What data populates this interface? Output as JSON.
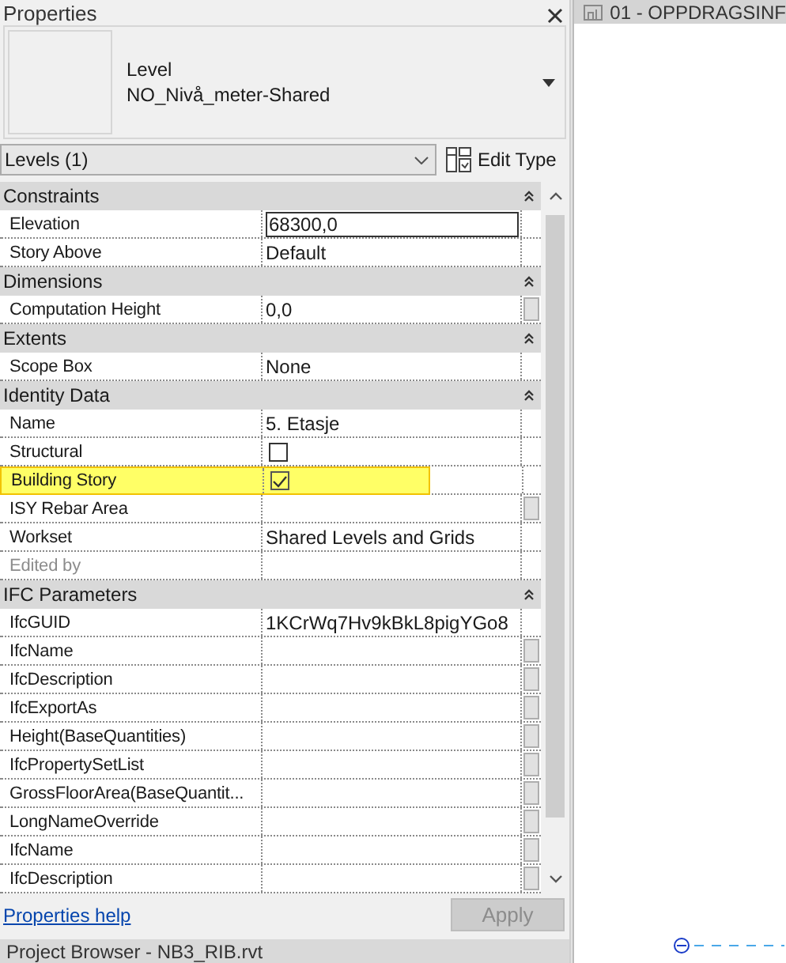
{
  "panel": {
    "title": "Properties",
    "type_selector": {
      "category": "Level",
      "type_name": "NO_Nivå_meter-Shared"
    },
    "filter": {
      "value": "Levels (1)"
    },
    "edit_type_button": "Edit Type"
  },
  "sections": [
    {
      "title": "Constraints",
      "expanded": true,
      "rows": [
        {
          "label": "Elevation",
          "kind": "input",
          "value": "68300,0",
          "button": false,
          "disabled": false,
          "highlighted": false
        },
        {
          "label": "Story Above",
          "kind": "text",
          "value": "Default",
          "button": false,
          "disabled": false,
          "highlighted": false
        }
      ]
    },
    {
      "title": "Dimensions",
      "expanded": true,
      "rows": [
        {
          "label": "Computation Height",
          "kind": "text",
          "value": "0,0",
          "button": true,
          "disabled": false,
          "highlighted": false
        }
      ]
    },
    {
      "title": "Extents",
      "expanded": true,
      "rows": [
        {
          "label": "Scope Box",
          "kind": "text",
          "value": "None",
          "button": false,
          "disabled": false,
          "highlighted": false
        }
      ]
    },
    {
      "title": "Identity Data",
      "expanded": true,
      "rows": [
        {
          "label": "Name",
          "kind": "text",
          "value": "5. Etasje",
          "button": false,
          "disabled": false,
          "highlighted": false
        },
        {
          "label": "Structural",
          "kind": "checkbox",
          "checked": false,
          "button": false,
          "disabled": false,
          "highlighted": false
        },
        {
          "label": "Building Story",
          "kind": "checkbox",
          "checked": true,
          "button": false,
          "disabled": false,
          "highlighted": true
        },
        {
          "label": "ISY Rebar Area",
          "kind": "text",
          "button": true,
          "disabled": false,
          "highlighted": false
        },
        {
          "label": "Workset",
          "kind": "text",
          "value": "Shared Levels and Grids",
          "button": false,
          "disabled": false,
          "highlighted": false
        },
        {
          "label": "Edited by",
          "kind": "text",
          "button": false,
          "disabled": true,
          "highlighted": false
        }
      ]
    },
    {
      "title": "IFC Parameters",
      "expanded": true,
      "rows": [
        {
          "label": "IfcGUID",
          "kind": "text",
          "value": "1KCrWq7Hv9kBkL8pigYGo8",
          "button": false,
          "disabled": false,
          "highlighted": false
        },
        {
          "label": "IfcName",
          "kind": "text",
          "button": true,
          "disabled": false,
          "highlighted": false
        },
        {
          "label": "IfcDescription",
          "kind": "text",
          "button": true,
          "disabled": false,
          "highlighted": false
        },
        {
          "label": "IfcExportAs",
          "kind": "text",
          "button": true,
          "disabled": false,
          "highlighted": false
        },
        {
          "label": "Height(BaseQuantities)",
          "kind": "text",
          "button": true,
          "disabled": false,
          "highlighted": false
        },
        {
          "label": "IfcPropertySetList",
          "kind": "text",
          "button": true,
          "disabled": false,
          "highlighted": false
        },
        {
          "label": "GrossFloorArea(BaseQuantit...",
          "kind": "text",
          "button": true,
          "disabled": false,
          "highlighted": false
        },
        {
          "label": "LongNameOverride",
          "kind": "text",
          "button": true,
          "disabled": false,
          "highlighted": false
        },
        {
          "label": "IfcName",
          "kind": "text",
          "button": true,
          "disabled": false,
          "highlighted": false
        },
        {
          "label": "IfcDescription",
          "kind": "text",
          "button": true,
          "disabled": false,
          "highlighted": false
        }
      ]
    }
  ],
  "footer": {
    "help_link": "Properties help",
    "apply_button": {
      "label": "Apply",
      "disabled": true
    }
  },
  "project_browser": {
    "title": "Project Browser - NB3_RIB.rvt"
  },
  "view": {
    "tab_title": "01 - OPPDRAGSINF"
  }
}
